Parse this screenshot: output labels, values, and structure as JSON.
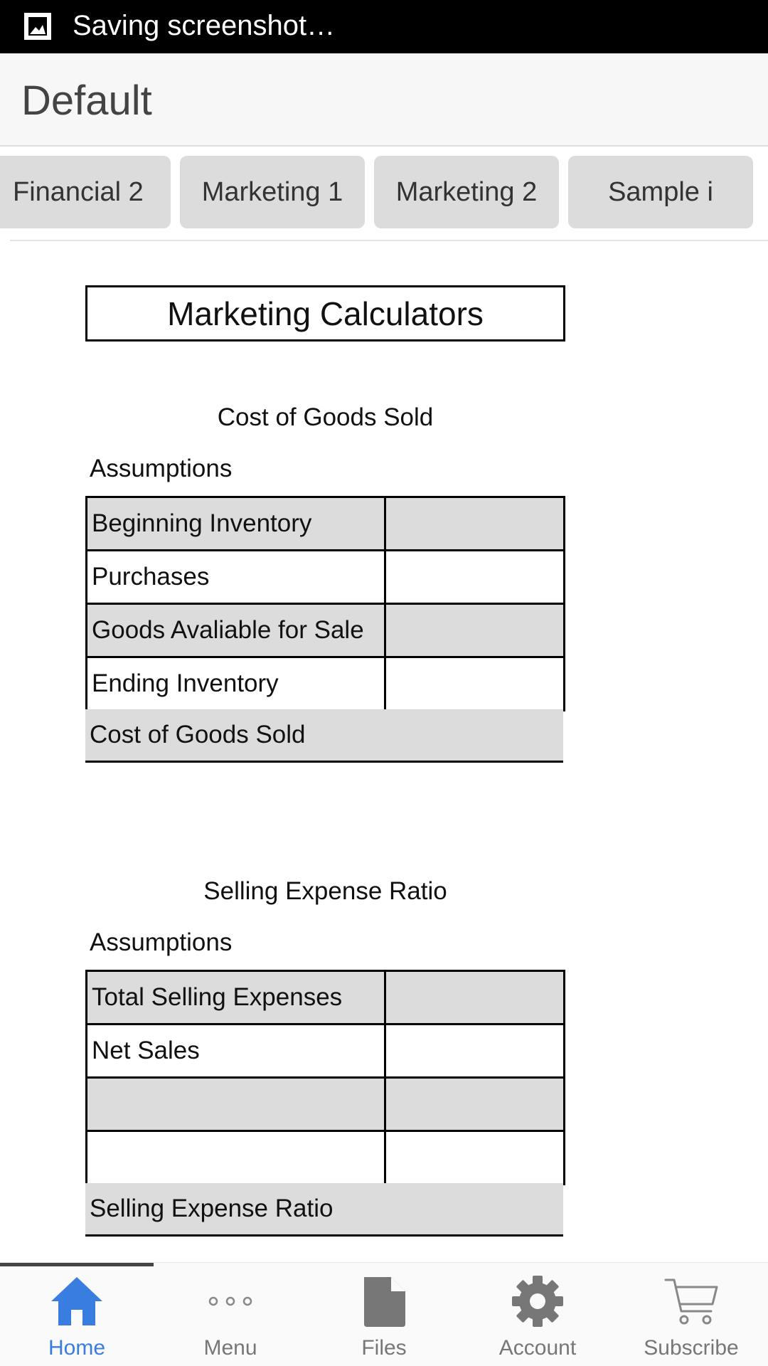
{
  "status_bar": {
    "text": "Saving screenshot…",
    "icon": "screenshot-icon"
  },
  "header": {
    "title": "Default"
  },
  "tabs": [
    {
      "label": "Financial 2"
    },
    {
      "label": "Marketing 1"
    },
    {
      "label": "Marketing 2"
    },
    {
      "label": "Sample i"
    }
  ],
  "page": {
    "title": "Marketing Calculators"
  },
  "cogs": {
    "title": "Cost of Goods Sold",
    "assumptions_label": "Assumptions",
    "rows": [
      {
        "label": "Beginning Inventory",
        "value": ""
      },
      {
        "label": "Purchases",
        "value": ""
      },
      {
        "label": "Goods Avaliable for Sale",
        "value": ""
      },
      {
        "label": "Ending Inventory",
        "value": ""
      }
    ],
    "result_label": "Cost of Goods Sold"
  },
  "ser": {
    "title": "Selling Expense Ratio",
    "assumptions_label": "Assumptions",
    "rows": [
      {
        "label": "Total Selling Expenses",
        "value": ""
      },
      {
        "label": "Net Sales",
        "value": ""
      },
      {
        "label": "",
        "value": ""
      },
      {
        "label": "",
        "value": ""
      }
    ],
    "result_label": "Selling Expense Ratio"
  },
  "bottom_nav": {
    "active_color": "#3a7de0",
    "inactive_color": "#777777",
    "items": [
      {
        "label": "Home",
        "icon": "home-icon",
        "active": true
      },
      {
        "label": "Menu",
        "icon": "more-dots-icon",
        "active": false
      },
      {
        "label": "Files",
        "icon": "file-icon",
        "active": false
      },
      {
        "label": "Account",
        "icon": "gear-icon",
        "active": false
      },
      {
        "label": "Subscribe",
        "icon": "cart-icon",
        "active": false
      }
    ]
  }
}
